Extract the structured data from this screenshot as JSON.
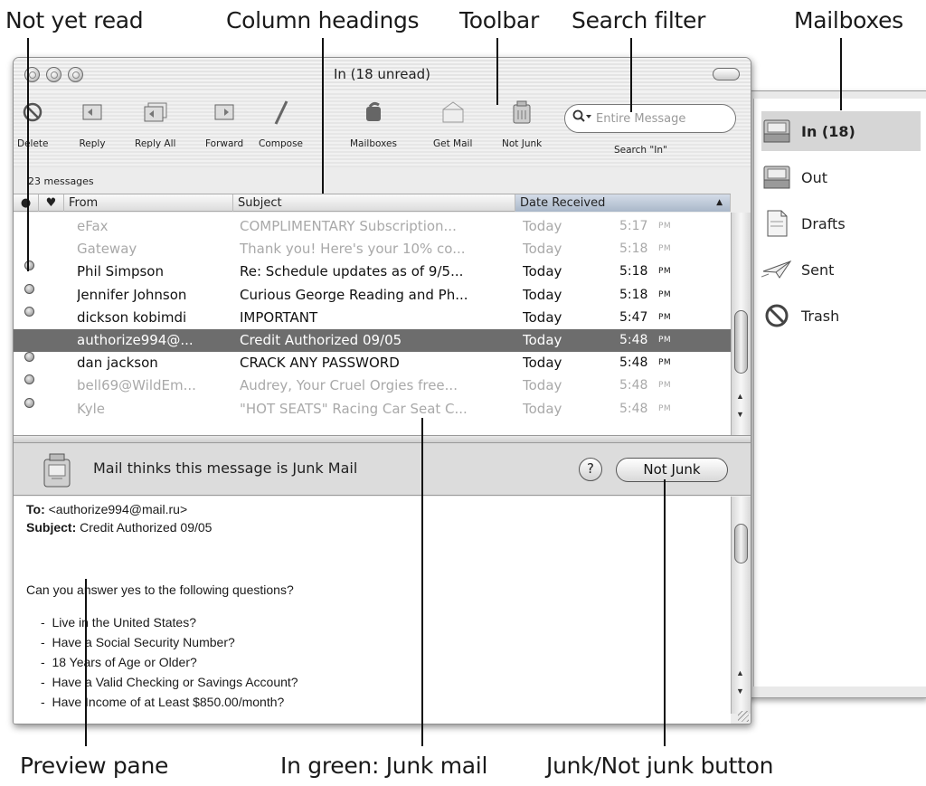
{
  "callouts": {
    "not_yet_read": "Not yet read",
    "column_headings": "Column headings",
    "toolbar": "Toolbar",
    "search_filter": "Search filter",
    "mailboxes": "Mailboxes",
    "preview_pane": "Preview pane",
    "junk_green": "In green: Junk mail",
    "junk_button": "Junk/Not junk button"
  },
  "window": {
    "title": "In (18 unread)",
    "message_count": "23 messages"
  },
  "toolbar": {
    "buttons": [
      {
        "label": "Delete",
        "icon": "delete-icon"
      },
      {
        "label": "Reply",
        "icon": "reply-icon"
      },
      {
        "label": "Reply All",
        "icon": "reply-all-icon"
      },
      {
        "label": "Forward",
        "icon": "forward-icon"
      },
      {
        "label": "Compose",
        "icon": "compose-icon"
      },
      {
        "label": "Mailboxes",
        "icon": "mailboxes-icon"
      },
      {
        "label": "Get Mail",
        "icon": "get-mail-icon"
      },
      {
        "label": "Not Junk",
        "icon": "not-junk-icon"
      }
    ],
    "search_placeholder": "Entire Message",
    "search_label": "Search \"In\""
  },
  "columns": {
    "from": "From",
    "subject": "Subject",
    "date": "Date Received",
    "sort_arrow": "▲"
  },
  "messages": [
    {
      "from": "eFax",
      "subject": "COMPLIMENTARY Subscription...",
      "date": "Today",
      "time": "5:17",
      "ampm": "PM",
      "unread": false,
      "junk": true
    },
    {
      "from": "Gateway",
      "subject": "Thank you! Here's your 10% co...",
      "date": "Today",
      "time": "5:18",
      "ampm": "PM",
      "unread": false,
      "junk": true
    },
    {
      "from": "Phil Simpson",
      "subject": "Re: Schedule updates as of 9/5...",
      "date": "Today",
      "time": "5:18",
      "ampm": "PM",
      "unread": true,
      "junk": false
    },
    {
      "from": "Jennifer Johnson",
      "subject": "Curious George Reading and Ph...",
      "date": "Today",
      "time": "5:18",
      "ampm": "PM",
      "unread": true,
      "junk": false
    },
    {
      "from": "dickson kobimdi",
      "subject": "IMPORTANT",
      "date": "Today",
      "time": "5:47",
      "ampm": "PM",
      "unread": true,
      "junk": false
    },
    {
      "from": "authorize994@...",
      "subject": "Credit Authorized 09/05",
      "date": "Today",
      "time": "5:48",
      "ampm": "PM",
      "unread": false,
      "junk": true,
      "selected": true
    },
    {
      "from": "dan jackson",
      "subject": "CRACK ANY PASSWORD",
      "date": "Today",
      "time": "5:48",
      "ampm": "PM",
      "unread": true,
      "junk": false
    },
    {
      "from": "bell69@WildEm...",
      "subject": "Audrey, Your Cruel Orgies free...",
      "date": "Today",
      "time": "5:48",
      "ampm": "PM",
      "unread": true,
      "junk": true
    },
    {
      "from": "Kyle",
      "subject": "\"HOT SEATS\" Racing Car Seat C...",
      "date": "Today",
      "time": "5:48",
      "ampm": "PM",
      "unread": true,
      "junk": true
    }
  ],
  "junk_bar": {
    "message": "Mail thinks this message is Junk Mail",
    "help": "?",
    "button": "Not Junk"
  },
  "preview": {
    "to_label": "To:",
    "to_value": "<authorize994@mail.ru>",
    "subject_label": "Subject:",
    "subject_value": "Credit Authorized 09/05",
    "body_question": "Can you answer yes to the following questions?",
    "bullets": [
      "Live in the United States?",
      "Have a Social Security Number?",
      "18 Years of Age or Older?",
      "Have a Valid Checking or Savings Account?",
      "Have Income of at Least $850.00/month?"
    ]
  },
  "mailboxes": [
    {
      "label": "In (18)",
      "icon": "inbox-icon",
      "selected": true
    },
    {
      "label": "Out",
      "icon": "outbox-icon"
    },
    {
      "label": "Drafts",
      "icon": "drafts-icon"
    },
    {
      "label": "Sent",
      "icon": "sent-icon"
    },
    {
      "label": "Trash",
      "icon": "trash-icon"
    }
  ]
}
